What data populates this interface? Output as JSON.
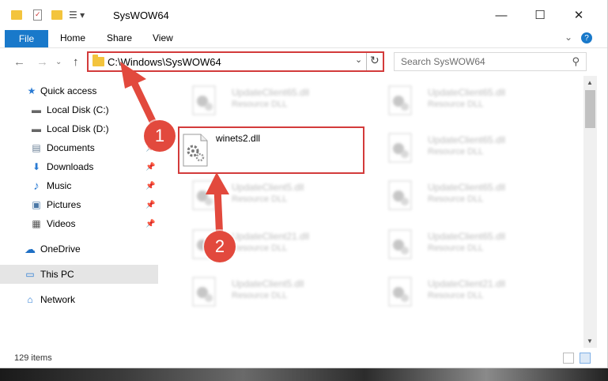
{
  "window": {
    "title": "SysWOW64",
    "minimize": "—",
    "maximize": "☐",
    "close": "✕"
  },
  "ribbon": {
    "tabs": [
      "File",
      "Home",
      "Share",
      "View"
    ],
    "collapse": "⌄",
    "help": "?"
  },
  "address": {
    "path": "C:\\Windows\\SysWOW64",
    "dropdown": "⌄",
    "refresh": "↻"
  },
  "search": {
    "placeholder": "Search SysWOW64",
    "icon": "⚲"
  },
  "nav_buttons": {
    "back": "←",
    "forward": "→",
    "recent": "⌄",
    "up": "↑"
  },
  "sidebar": {
    "items": [
      {
        "label": "Quick access",
        "icon": "star-icon",
        "glyph": "★"
      },
      {
        "label": "Local Disk (C:)",
        "icon": "drive-icon",
        "glyph": "▬"
      },
      {
        "label": "Local Disk (D:)",
        "icon": "drive-icon",
        "glyph": "▬"
      },
      {
        "label": "Documents",
        "icon": "document-icon",
        "glyph": "▤"
      },
      {
        "label": "Downloads",
        "icon": "download-icon",
        "glyph": "⬇"
      },
      {
        "label": "Music",
        "icon": "music-icon",
        "glyph": "♪"
      },
      {
        "label": "Pictures",
        "icon": "pictures-icon",
        "glyph": "▣"
      },
      {
        "label": "Videos",
        "icon": "videos-icon",
        "glyph": "▦"
      },
      {
        "label": "OneDrive",
        "icon": "cloud-icon",
        "glyph": "☁"
      },
      {
        "label": "This PC",
        "icon": "computer-icon",
        "glyph": "▭"
      },
      {
        "label": "Network",
        "icon": "network-icon",
        "glyph": "⌂"
      }
    ],
    "pin_glyph": "📌"
  },
  "files": {
    "col1": [
      {
        "name": "UpdateClient65.dll",
        "desc": "Resource DLL"
      },
      {
        "name": "winets2.dll",
        "desc": ""
      },
      {
        "name": "UpdateClient5.dll",
        "desc": "Resource DLL"
      },
      {
        "name": "UpdateClient21.dll",
        "desc": "Resource DLL"
      },
      {
        "name": "UpdateClient5.dll",
        "desc": "Resource DLL"
      }
    ],
    "col2": [
      {
        "name": "UpdateClient65.dll",
        "desc": "Resource DLL"
      },
      {
        "name": "UpdateClient65.dll",
        "desc": "Resource DLL"
      },
      {
        "name": "UpdateClient65.dll",
        "desc": "Resource DLL"
      },
      {
        "name": "UpdateClient65.dll",
        "desc": "Resource DLL"
      },
      {
        "name": "UpdateClient21.dll",
        "desc": "Resource DLL"
      }
    ]
  },
  "status": {
    "items": "129 items"
  },
  "annotations": {
    "step1": "1",
    "step2": "2"
  },
  "colors": {
    "accent": "#1979ca",
    "annotation": "#e2493d",
    "highlight_border": "#d33b3b"
  }
}
